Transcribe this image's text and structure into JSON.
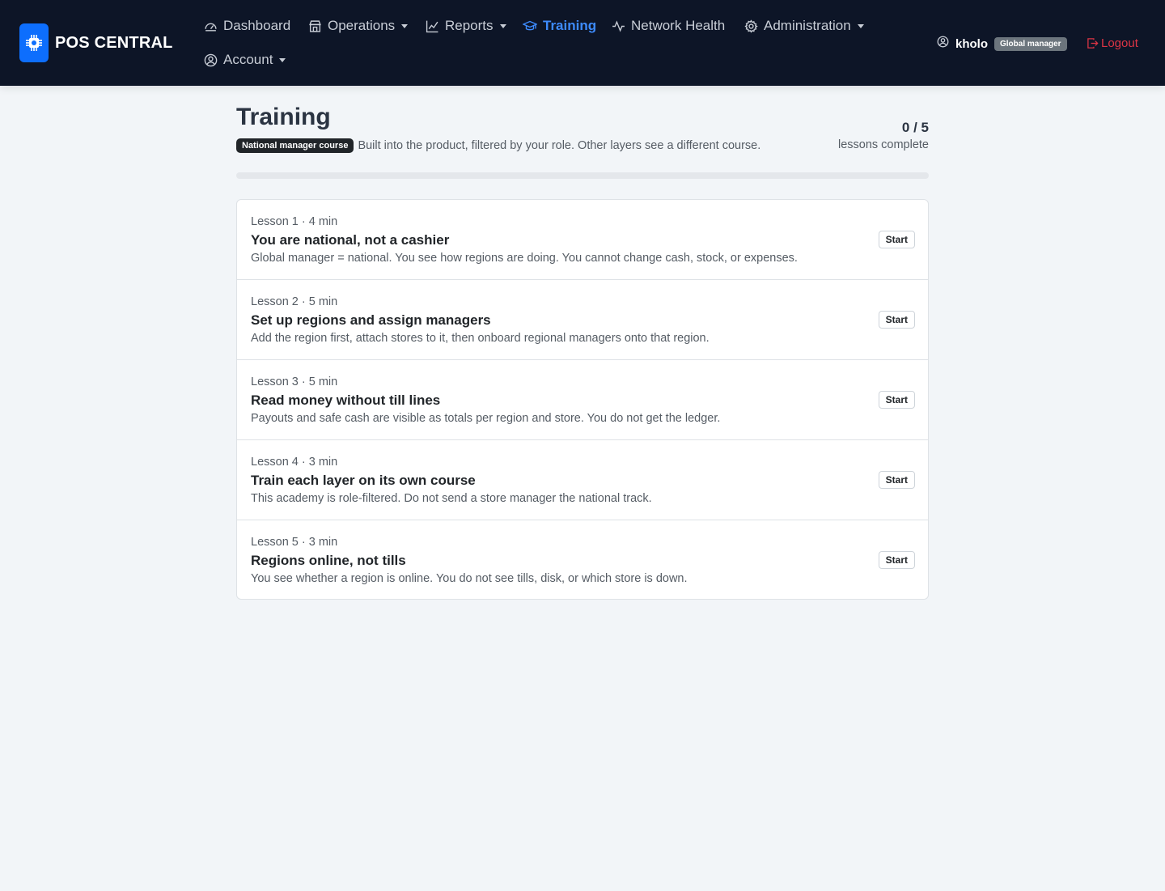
{
  "brand": {
    "name": "POS CENTRAL",
    "accent": "#0d6efd"
  },
  "nav": {
    "dashboard": "Dashboard",
    "operations": "Operations",
    "reports": "Reports",
    "training": "Training",
    "network_health": "Network Health",
    "administration": "Administration",
    "account": "Account"
  },
  "user": {
    "name": "kholo",
    "role": "Global manager"
  },
  "logout_label": "Logout",
  "page": {
    "title": "Training",
    "course_badge": "National manager course",
    "subtitle": "Built into the product, filtered by your role. Other layers see a different course.",
    "progress_count": "0 / 5",
    "progress_label": "lessons complete",
    "progress_fraction": 0
  },
  "lessons": [
    {
      "meta": "Lesson 1 · 4 min",
      "title": "You are national, not a cashier",
      "description": "Global manager = national. You see how regions are doing. You cannot change cash, stock, or expenses.",
      "action": "Start"
    },
    {
      "meta": "Lesson 2 · 5 min",
      "title": "Set up regions and assign managers",
      "description": "Add the region first, attach stores to it, then onboard regional managers onto that region.",
      "action": "Start"
    },
    {
      "meta": "Lesson 3 · 5 min",
      "title": "Read money without till lines",
      "description": "Payouts and safe cash are visible as totals per region and store. You do not get the ledger.",
      "action": "Start"
    },
    {
      "meta": "Lesson 4 · 3 min",
      "title": "Train each layer on its own course",
      "description": "This academy is role-filtered. Do not send a store manager the national track.",
      "action": "Start"
    },
    {
      "meta": "Lesson 5 · 3 min",
      "title": "Regions online, not tills",
      "description": "You see whether a region is online. You do not see tills, disk, or which store is down.",
      "action": "Start"
    }
  ],
  "colors": {
    "nav_bg": "#0d1527",
    "active": "#3d8bfd",
    "logout": "#dc3545",
    "page_bg": "#f2f5f8"
  }
}
